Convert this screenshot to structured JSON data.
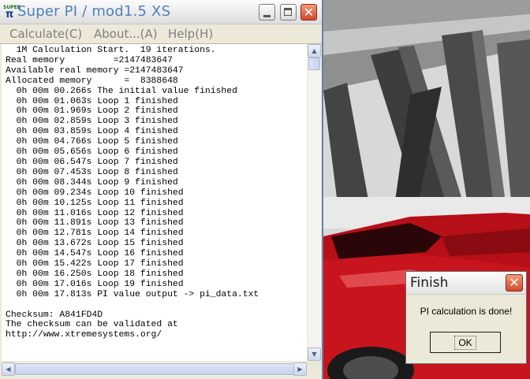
{
  "main_window": {
    "title": "Super PI / mod1.5 XS",
    "icon_name": "super-pi-app-icon",
    "icon_label": "SUPER",
    "icon_glyph": "π",
    "buttons": {
      "minimize": "minimize-icon",
      "maximize": "maximize-icon",
      "close": "close-icon"
    },
    "menu": [
      {
        "label": "Calculate(C)"
      },
      {
        "label": "About...(A)"
      },
      {
        "label": "Help(H)"
      }
    ]
  },
  "log": {
    "lines": [
      "  1M Calculation Start.  19 iterations.",
      "Real memory         =2147483647",
      "Available real memory =2147483647",
      "Allocated memory      =  8388648",
      "  0h 00m 00.266s The initial value finished",
      "  0h 00m 01.063s Loop 1 finished",
      "  0h 00m 01.969s Loop 2 finished",
      "  0h 00m 02.859s Loop 3 finished",
      "  0h 00m 03.859s Loop 4 finished",
      "  0h 00m 04.766s Loop 5 finished",
      "  0h 00m 05.656s Loop 6 finished",
      "  0h 00m 06.547s Loop 7 finished",
      "  0h 00m 07.453s Loop 8 finished",
      "  0h 00m 08.344s Loop 9 finished",
      "  0h 00m 09.234s Loop 10 finished",
      "  0h 00m 10.125s Loop 11 finished",
      "  0h 00m 11.016s Loop 12 finished",
      "  0h 00m 11.891s Loop 13 finished",
      "  0h 00m 12.781s Loop 14 finished",
      "  0h 00m 13.672s Loop 15 finished",
      "  0h 00m 14.547s Loop 16 finished",
      "  0h 00m 15.422s Loop 17 finished",
      "  0h 00m 16.250s Loop 18 finished",
      "  0h 00m 17.016s Loop 19 finished",
      "  0h 00m 17.813s PI value output -> pi_data.txt",
      "",
      "Checksum: A841FD4D",
      "The checksum can be validated at",
      "http://www.xtremesystems.org/"
    ]
  },
  "scrollbars": {
    "up_arrow": "▲",
    "down_arrow": "▼",
    "left_arrow": "◀",
    "right_arrow": "▶"
  },
  "dialog": {
    "title": "Finish",
    "close_glyph": "✕",
    "message": "PI calculation is done!",
    "ok_label": "OK"
  },
  "colors": {
    "title_text": "#4f7fbf",
    "close_button": "#d24a2b",
    "wallpaper_car": "#c8141c"
  }
}
